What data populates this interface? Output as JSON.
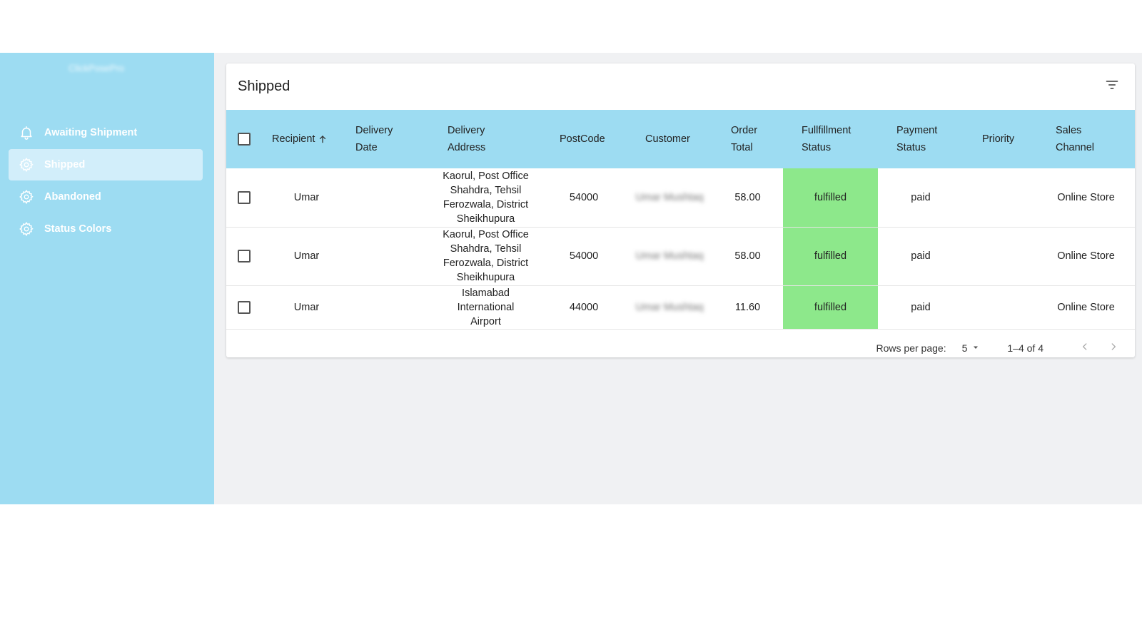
{
  "app": {
    "logo_text": "ClickPosePro"
  },
  "sidebar": {
    "items": [
      {
        "label": "Awaiting Shipment",
        "icon": "bell-icon"
      },
      {
        "label": "Shipped",
        "icon": "gear-icon"
      },
      {
        "label": "Abandoned",
        "icon": "gear-icon"
      },
      {
        "label": "Status Colors",
        "icon": "gear-icon"
      }
    ]
  },
  "page": {
    "title": "Shipped"
  },
  "table": {
    "headers": {
      "recipient": "Recipient",
      "delivery_date": [
        "Delivery",
        "Date"
      ],
      "delivery_address": [
        "Delivery",
        "Address"
      ],
      "postcode": "PostCode",
      "customer": "Customer",
      "order_total": [
        "Order",
        "Total"
      ],
      "fulfillment_status": [
        "Fullfillment",
        "Status"
      ],
      "payment_status": [
        "Payment",
        "Status"
      ],
      "priority": "Priority",
      "sales_channel": [
        "Sales",
        "Channel"
      ]
    },
    "rows": [
      {
        "recipient": "Umar",
        "delivery_date": "",
        "address_lines": [
          "Kaorul, Post Office",
          "Shahdra, Tehsil",
          "Ferozwala, District",
          "Sheikhupura"
        ],
        "postcode": "54000",
        "customer": "Umar Mushtaq",
        "order_total": "58.00",
        "fulfillment_status": "fulfilled",
        "payment_status": "paid",
        "priority": "",
        "sales_channel": "Online Store"
      },
      {
        "recipient": "Umar",
        "delivery_date": "",
        "address_lines": [
          "Kaorul, Post Office",
          "Shahdra, Tehsil",
          "Ferozwala, District",
          "Sheikhupura"
        ],
        "postcode": "54000",
        "customer": "Umar Mushtaq",
        "order_total": "58.00",
        "fulfillment_status": "fulfilled",
        "payment_status": "paid",
        "priority": "",
        "sales_channel": "Online Store"
      },
      {
        "recipient": "Umar",
        "delivery_date": "",
        "address_lines": [
          "Islamabad International",
          "Airport"
        ],
        "postcode": "44000",
        "customer": "Umar Mushtaq",
        "order_total": "11.60",
        "fulfillment_status": "fulfilled",
        "payment_status": "paid",
        "priority": "",
        "sales_channel": "Online Store"
      }
    ]
  },
  "pagination": {
    "rows_per_page_label": "Rows per page:",
    "rows_per_page_value": "5",
    "range": "1–4 of 4"
  },
  "colors": {
    "sidebar_bg": "#9ddcf2",
    "active_nav_bg": "#d2eefa",
    "header_row_bg": "#9ddcf2",
    "fulfilled_bg": "#8de88b",
    "content_bg": "#f0f1f3"
  }
}
